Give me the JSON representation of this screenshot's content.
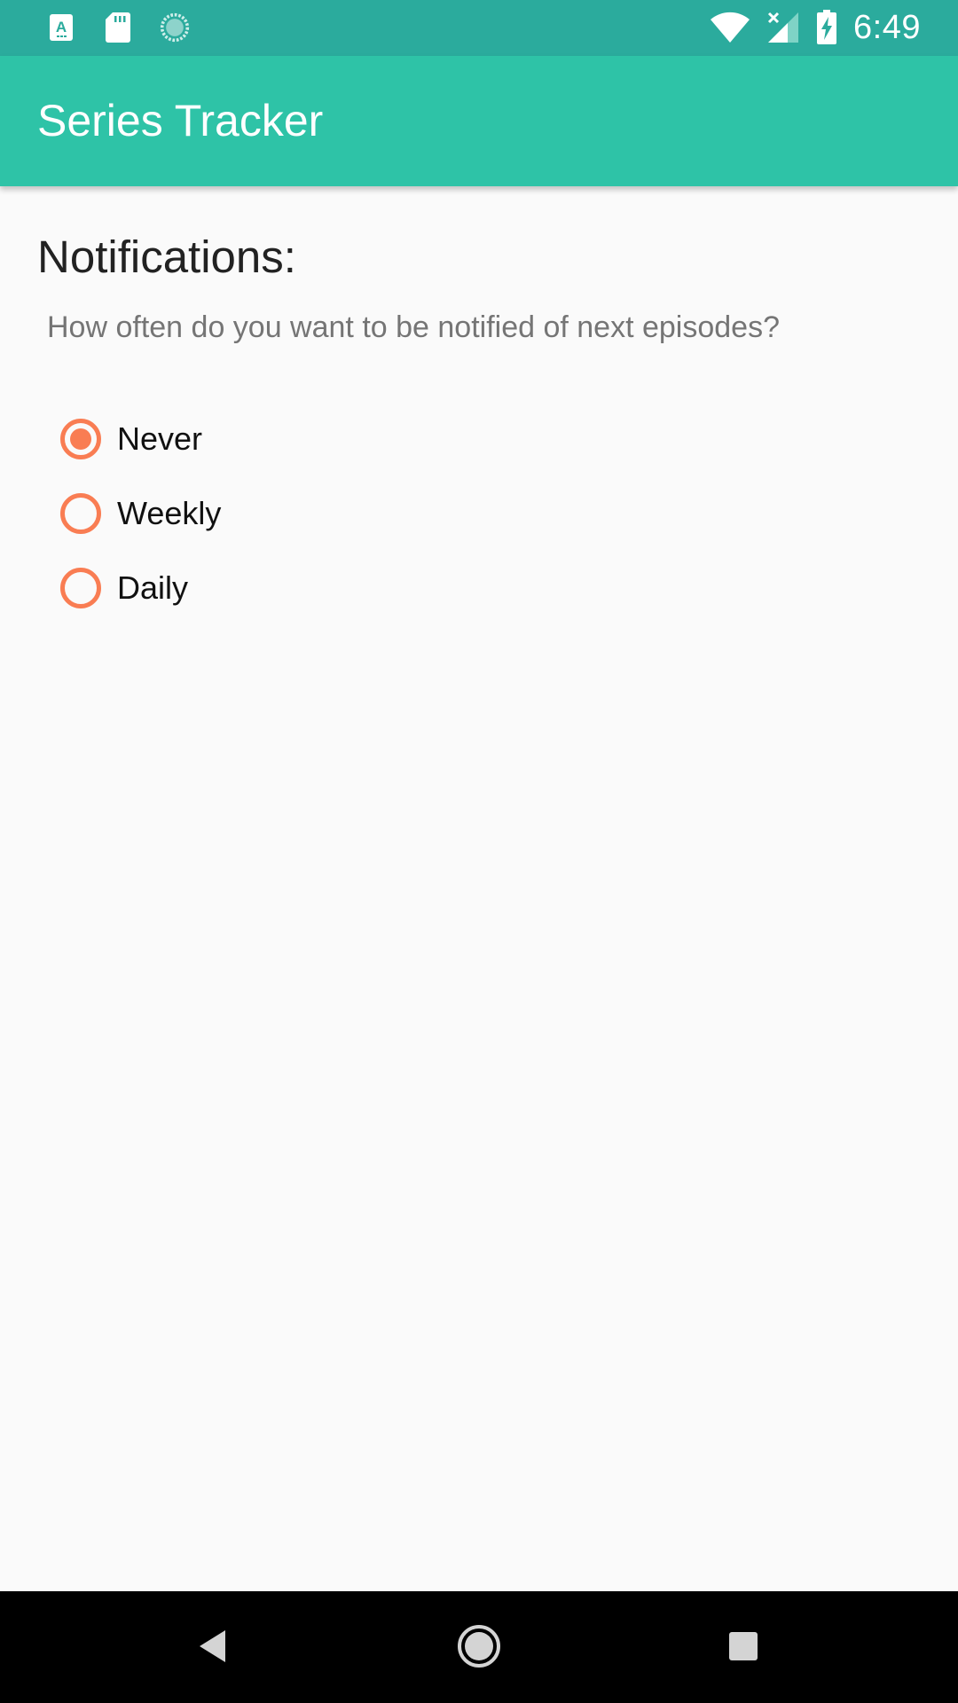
{
  "status_bar": {
    "time": "6:49",
    "icons": [
      "keyboard-a-icon",
      "sd-card-icon",
      "loading-circle-icon",
      "wifi-icon",
      "cell-signal-off-icon",
      "battery-charging-icon"
    ]
  },
  "app_bar": {
    "title": "Series Tracker"
  },
  "notifications": {
    "heading": "Notifications:",
    "question": "How often do you want to be notified of next episodes?",
    "options": [
      {
        "label": "Never",
        "checked": true
      },
      {
        "label": "Weekly",
        "checked": false
      },
      {
        "label": "Daily",
        "checked": false
      }
    ]
  },
  "nav_bar": {
    "icons": [
      "back-icon",
      "home-icon",
      "recents-icon"
    ]
  },
  "colors": {
    "status_bar": "#2bab9d",
    "app_bar": "#2ec3a7",
    "accent": "#f97d53",
    "background": "#fafafa"
  }
}
